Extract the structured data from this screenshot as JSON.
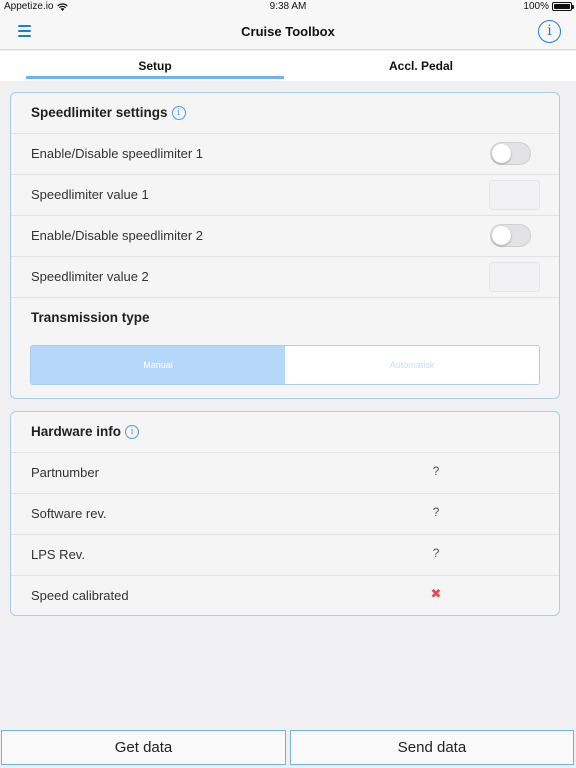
{
  "status_bar": {
    "carrier": "Appetize.io",
    "time": "9:38 AM",
    "battery": "100%"
  },
  "navbar": {
    "title": "Cruise Toolbox",
    "info_icon": "i"
  },
  "tabs": [
    {
      "label": "Setup",
      "active": true
    },
    {
      "label": "Accl. Pedal",
      "active": false
    }
  ],
  "speedlimiter": {
    "title": "Speedlimiter settings",
    "enable1_label": "Enable/Disable speedlimiter 1",
    "enable1_on": false,
    "value1_label": "Speedlimiter value 1",
    "value1": "",
    "enable2_label": "Enable/Disable speedlimiter 2",
    "enable2_on": false,
    "value2_label": "Speedlimiter value 2",
    "value2": "",
    "transmission_title": "Transmission type",
    "transmission_options": [
      "Manual",
      "Automatisk"
    ],
    "transmission_selected": "Manual"
  },
  "hardware": {
    "title": "Hardware info",
    "rows": [
      {
        "label": "Partnumber",
        "value": "?"
      },
      {
        "label": "Software rev.",
        "value": "?"
      },
      {
        "label": "LPS Rev.",
        "value": "?"
      },
      {
        "label": "Speed calibrated",
        "value": "✖"
      }
    ]
  },
  "buttons": {
    "get_data": "Get data",
    "send_data": "Send data"
  },
  "colors": {
    "accent": "#1a7be0",
    "card_border": "#a9cdee",
    "selected_segment": "#b5d7fa",
    "error": "#e84949"
  }
}
